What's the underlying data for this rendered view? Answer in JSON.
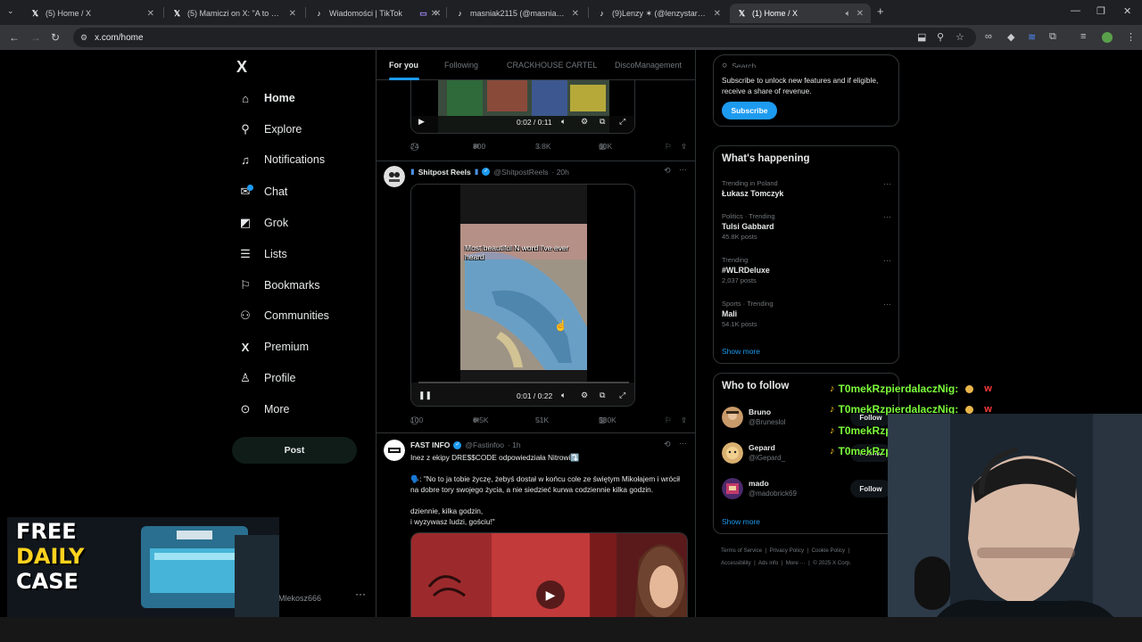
{
  "browser": {
    "tabs": [
      {
        "title": "(5) Home / X",
        "favicon": "X"
      },
      {
        "title": "(5) Mamiczi on X: \"A to wiecie",
        "favicon": "X"
      },
      {
        "title": "Wiadomości | TikTok",
        "favicon": "tiktok"
      },
      {
        "title": "",
        "favicon": "media"
      },
      {
        "title": "masniak2115 (@masniak2115)",
        "favicon": "tiktok"
      },
      {
        "title": "(9)Lenzy ✶ (@lenzystar) | TikTok",
        "favicon": "tiktok"
      },
      {
        "title": "(1) Home / X",
        "favicon": "X",
        "active": true
      }
    ],
    "url": "x.com/home"
  },
  "nav": {
    "logo": "X",
    "items": [
      {
        "label": "Home",
        "icon": "home-icon",
        "glyph": "⌂"
      },
      {
        "label": "Explore",
        "icon": "search-icon",
        "glyph": "⚲"
      },
      {
        "label": "Notifications",
        "icon": "bell-icon",
        "glyph": "🔔︎"
      },
      {
        "label": "Chat",
        "icon": "mail-icon",
        "glyph": "✉"
      },
      {
        "label": "Grok",
        "icon": "grok-icon",
        "glyph": "◩"
      },
      {
        "label": "Lists",
        "icon": "list-icon",
        "glyph": "☰"
      },
      {
        "label": "Bookmarks",
        "icon": "bookmark-icon",
        "glyph": "⚑"
      },
      {
        "label": "Communities",
        "icon": "people-icon",
        "glyph": "⚇"
      },
      {
        "label": "Premium",
        "icon": "x-logo-icon",
        "glyph": "X"
      },
      {
        "label": "Profile",
        "icon": "person-icon",
        "glyph": "⚲"
      },
      {
        "label": "More",
        "icon": "more-circle-icon",
        "glyph": "⊙"
      }
    ],
    "post_label": "Post",
    "account_handle": "Mlekosz666"
  },
  "timeline": {
    "tabs": [
      "For you",
      "Following",
      "CRACKHOUSE CARTEL",
      "DiscoManagement"
    ],
    "post0": {
      "video_time": "0:02 / 0:11",
      "replies": "24",
      "reposts": "300",
      "likes": "3.8K",
      "views": "60K"
    },
    "post1": {
      "name": "Shitpost Reels",
      "handle": "@ShitpostReels",
      "time": "· 20h",
      "video_caption": "Most beautiful N word I've ever heard",
      "video_time": "0:01 / 0:22",
      "replies": "100",
      "reposts": "6.5K",
      "likes": "51K",
      "views": "580K"
    },
    "post2": {
      "name": "FAST INFO",
      "handle": "@Fastinfoo",
      "time": "· 1h",
      "line1": "Inez z ekipy DRE$$CODE odpowiedziała Nitrowi⤵️",
      "quote": "🗣️: \"No to ja tobie życzę, żebyś dostał w końcu cole ze świętym Mikołajem i wrócił na dobre tory swojego życia, a nie siedzieć kurwa codziennie kilka godzin.",
      "quote2": "dziennie, kilka godzin,",
      "quote3": "i wyzywasz ludzi, gościu!\""
    }
  },
  "right": {
    "search_placeholder": "Search",
    "premium_text": "Subscribe to unlock new features and if eligible, receive a share of revenue.",
    "subscribe_label": "Subscribe",
    "whats_happening_title": "What's happening",
    "trends": [
      {
        "context": "Trending in Poland",
        "name": "Łukasz Tomczyk",
        "count": ""
      },
      {
        "context": "Politics · Trending",
        "name": "Tulsi Gabbard",
        "count": "45.8K posts"
      },
      {
        "context": "Trending",
        "name": "#WLRDeluxe",
        "count": "2,037 posts"
      },
      {
        "context": "Sports · Trending",
        "name": "Mali",
        "count": "54.1K posts"
      }
    ],
    "show_more": "Show more",
    "who_to_follow_title": "Who to follow",
    "follow_suggestions": [
      {
        "name": "Bruno",
        "handle": "@Bruneslol",
        "button": "Follow"
      },
      {
        "name": "Gepard",
        "handle": "@iGepard_",
        "button": "Follow"
      },
      {
        "name": "mado",
        "handle": "@madobrick69",
        "button": "Follow"
      }
    ],
    "show_more_2": "Show more",
    "footer_line1": [
      "Terms of Service",
      "Privacy Policy",
      "Cookie Policy"
    ],
    "footer_line2": [
      "Accessibility",
      "Ads info",
      "More ···",
      "© 2025 X Corp."
    ]
  },
  "overlay": {
    "chat_user": "T0mekRzpierdalaczNig:",
    "chat_msg": "w",
    "promo_line1": "FREE",
    "promo_line2": "DAILY",
    "promo_line3": "CASE"
  }
}
